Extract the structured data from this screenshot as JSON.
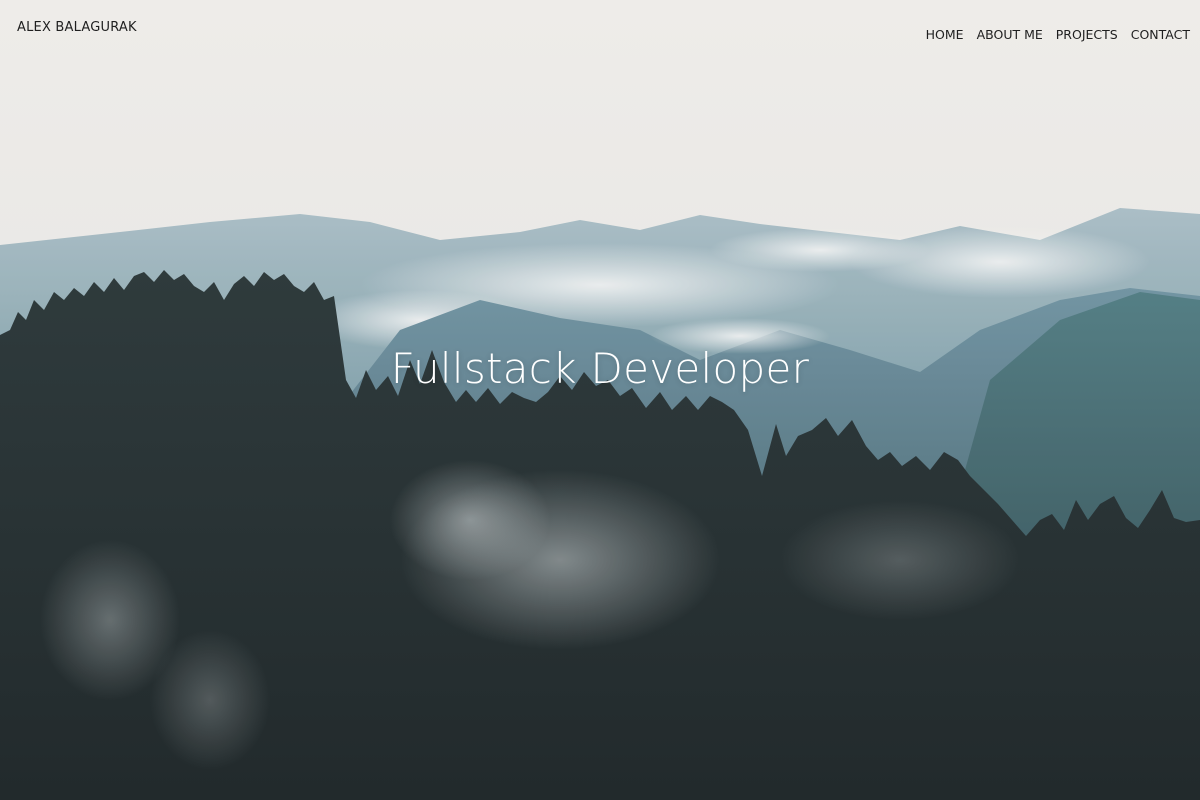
{
  "header": {
    "brand": "ALEX BALAGURAK",
    "nav": [
      {
        "label": "HOME"
      },
      {
        "label": "ABOUT ME"
      },
      {
        "label": "PROJECTS"
      },
      {
        "label": "CONTACT"
      }
    ]
  },
  "hero": {
    "title": "Fullstack Developer"
  },
  "colors": {
    "sky": "#eceae6",
    "forest": "#1c2628",
    "mountain": "#5d8191",
    "text_dark": "#1f1f1f",
    "text_light": "#ffffff"
  }
}
